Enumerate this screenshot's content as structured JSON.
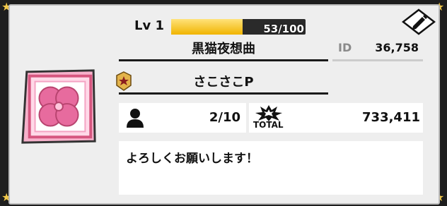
{
  "profile": {
    "level_label": "Lv 1",
    "xp_text": "53/100",
    "xp_fraction": 0.53,
    "team_name": "黒猫夜想曲",
    "id_label": "ID",
    "id_value": "36,758",
    "player_name": "さこさこP",
    "friends_count": "2/10",
    "total_label": "TOTAL",
    "total_value": "733,411",
    "comment": "よろしくお願いします！"
  },
  "colors": {
    "accent_gold": "#f2c94c",
    "xp_fill": "#f0b400",
    "emblem_pink": "#e76b9e"
  },
  "icons": {
    "edit": "pencil-icon",
    "rank": "rank-badge-icon",
    "friends": "person-icon",
    "total": "burst-icon",
    "emblem": "clover-emblem-icon",
    "corner": "star-icon"
  }
}
